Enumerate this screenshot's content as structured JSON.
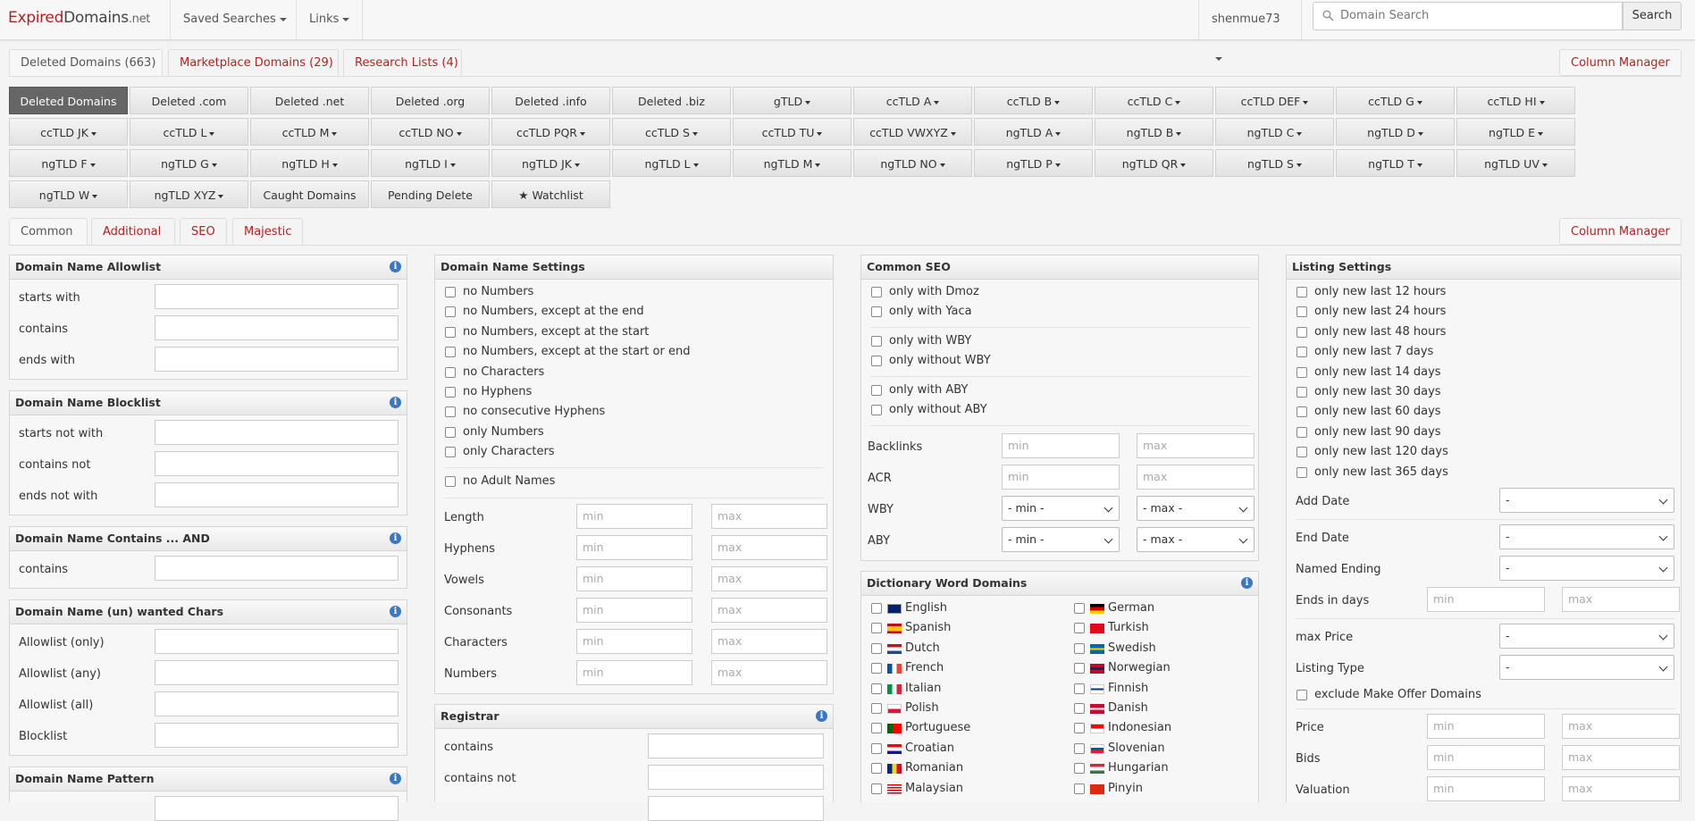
{
  "brand": {
    "part1": "Expired",
    "part2": "Domains",
    "part3": ".net"
  },
  "nav": {
    "saved_searches": "Saved Searches",
    "links": "Links",
    "user": "shenmue73",
    "search_placeholder": "Domain Search",
    "search_button": "Search"
  },
  "top_tabs": [
    "Deleted Domains (663)",
    "Marketplace Domains (29)",
    "Research Lists (4)"
  ],
  "column_manager": "Column Manager",
  "filter_rows": [
    [
      {
        "label": "Deleted Domains",
        "dd": false,
        "active": true
      },
      {
        "label": "Deleted .com",
        "dd": false
      },
      {
        "label": "Deleted .net",
        "dd": false
      },
      {
        "label": "Deleted .org",
        "dd": false
      },
      {
        "label": "Deleted .info",
        "dd": false
      },
      {
        "label": "Deleted .biz",
        "dd": false
      },
      {
        "label": "gTLD",
        "dd": true
      },
      {
        "label": "ccTLD A",
        "dd": true
      },
      {
        "label": "ccTLD B",
        "dd": true
      },
      {
        "label": "ccTLD C",
        "dd": true
      },
      {
        "label": "ccTLD DEF",
        "dd": true
      },
      {
        "label": "ccTLD G",
        "dd": true
      },
      {
        "label": "ccTLD HI",
        "dd": true
      }
    ],
    [
      {
        "label": "ccTLD JK",
        "dd": true
      },
      {
        "label": "ccTLD L",
        "dd": true
      },
      {
        "label": "ccTLD M",
        "dd": true
      },
      {
        "label": "ccTLD NO",
        "dd": true
      },
      {
        "label": "ccTLD PQR",
        "dd": true
      },
      {
        "label": "ccTLD S",
        "dd": true
      },
      {
        "label": "ccTLD TU",
        "dd": true
      },
      {
        "label": "ccTLD VWXYZ",
        "dd": true
      },
      {
        "label": "ngTLD A",
        "dd": true
      },
      {
        "label": "ngTLD B",
        "dd": true
      },
      {
        "label": "ngTLD C",
        "dd": true
      },
      {
        "label": "ngTLD D",
        "dd": true
      },
      {
        "label": "ngTLD E",
        "dd": true
      }
    ],
    [
      {
        "label": "ngTLD F",
        "dd": true
      },
      {
        "label": "ngTLD G",
        "dd": true
      },
      {
        "label": "ngTLD H",
        "dd": true
      },
      {
        "label": "ngTLD I",
        "dd": true
      },
      {
        "label": "ngTLD JK",
        "dd": true
      },
      {
        "label": "ngTLD L",
        "dd": true
      },
      {
        "label": "ngTLD M",
        "dd": true
      },
      {
        "label": "ngTLD NO",
        "dd": true
      },
      {
        "label": "ngTLD P",
        "dd": true
      },
      {
        "label": "ngTLD QR",
        "dd": true
      },
      {
        "label": "ngTLD S",
        "dd": true
      },
      {
        "label": "ngTLD T",
        "dd": true
      },
      {
        "label": "ngTLD UV",
        "dd": true
      }
    ],
    [
      {
        "label": "ngTLD W",
        "dd": true
      },
      {
        "label": "ngTLD XYZ",
        "dd": true
      },
      {
        "label": "Caught Domains",
        "dd": false
      },
      {
        "label": "Pending Delete",
        "dd": false
      },
      {
        "label": "★ Watchlist",
        "dd": false
      }
    ]
  ],
  "sub_tabs": [
    "Common",
    "Additional",
    "SEO",
    "Majestic"
  ],
  "col1": {
    "allowlist": {
      "title": "Domain Name Allowlist",
      "fields": [
        "starts with",
        "contains",
        "ends with"
      ]
    },
    "blocklist": {
      "title": "Domain Name Blocklist",
      "fields": [
        "starts not with",
        "contains not",
        "ends not with"
      ]
    },
    "contains_and": {
      "title": "Domain Name Contains ... AND",
      "fields": [
        "contains"
      ]
    },
    "chars": {
      "title": "Domain Name (un) wanted Chars",
      "fields": [
        "Allowlist (only)",
        "Allowlist (any)",
        "Allowlist (all)",
        "Blocklist"
      ]
    },
    "pattern": {
      "title": "Domain Name Pattern"
    }
  },
  "col2": {
    "settings_title": "Domain Name Settings",
    "checks": [
      "no Numbers",
      "no Numbers, except at the end",
      "no Numbers, except at the start",
      "no Numbers, except at the start or end",
      "no Characters",
      "no Hyphens",
      "no consecutive Hyphens",
      "only Numbers",
      "only Characters"
    ],
    "adult": "no Adult Names",
    "ranges": [
      "Length",
      "Hyphens",
      "Vowels",
      "Consonants",
      "Characters",
      "Numbers"
    ],
    "min": "min",
    "max": "max",
    "registrar_title": "Registrar",
    "registrar_fields": [
      "contains",
      "contains not"
    ]
  },
  "col3": {
    "seo_title": "Common SEO",
    "group1": [
      "only with Dmoz",
      "only with Yaca"
    ],
    "group2": [
      "only with WBY",
      "only without WBY"
    ],
    "group3": [
      "only with ABY",
      "only without ABY"
    ],
    "backlinks": "Backlinks",
    "acr": "ACR",
    "wby": "WBY",
    "aby": "ABY",
    "sel_min": "- min -",
    "sel_max": "- max -",
    "dict_title": "Dictionary Word Domains",
    "langs_left": [
      "English",
      "Spanish",
      "Dutch",
      "French",
      "Italian",
      "Polish",
      "Portuguese",
      "Croatian",
      "Romanian",
      "Malaysian"
    ],
    "langs_right": [
      "German",
      "Turkish",
      "Swedish",
      "Norwegian",
      "Finnish",
      "Danish",
      "Indonesian",
      "Slovenian",
      "Hungarian",
      "Pinyin"
    ]
  },
  "col4": {
    "title": "Listing Settings",
    "checks": [
      "only new last 12 hours",
      "only new last 24 hours",
      "only new last 48 hours",
      "only new last 7 days",
      "only new last 14 days",
      "only new last 30 days",
      "only new last 60 days",
      "only new last 90 days",
      "only new last 120 days",
      "only new last 365 days"
    ],
    "add_date": "Add Date",
    "end_date": "End Date",
    "named_ending": "Named Ending",
    "ends_in_days": "Ends in days",
    "max_price": "max Price",
    "listing_type": "Listing Type",
    "exclude": "exclude Make Offer Domains",
    "price": "Price",
    "bids": "Bids",
    "valuation": "Valuation",
    "dash": "-"
  }
}
